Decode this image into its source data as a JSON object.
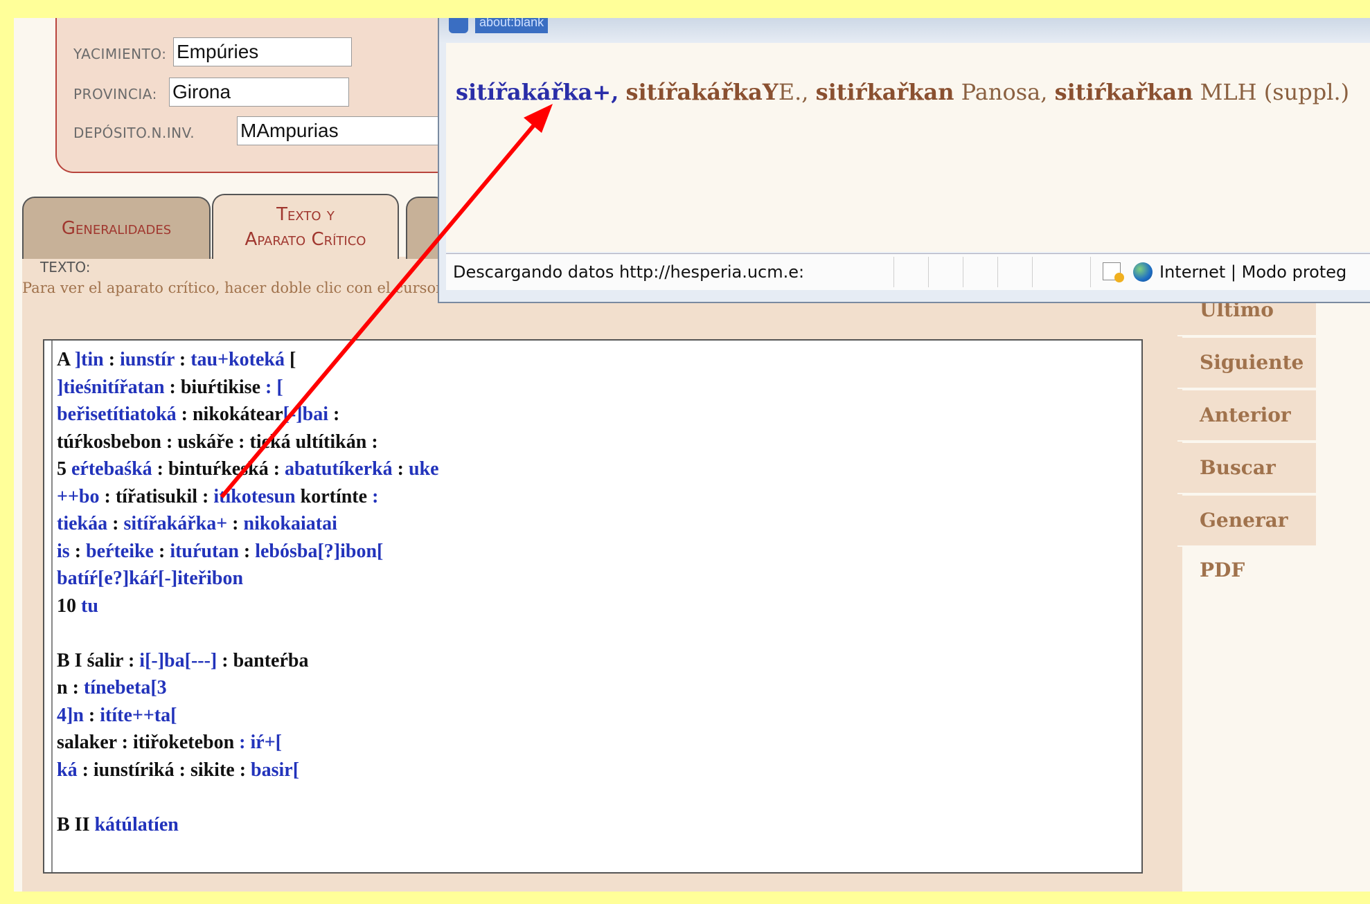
{
  "info": {
    "yacimiento_label": "YACIMIENTO:",
    "yacimiento_value": "Empúries",
    "provincia_label": "PROVINCIA:",
    "provincia_value": "Girona",
    "deposito_label": "DEPÓSITO.N.INV.",
    "deposito_value": "MAmpurias"
  },
  "tabs": {
    "generalidades": "Generalidades",
    "texto_line1": "Texto y",
    "texto_line2": "Aparato Crítico"
  },
  "texto_label": "TEXTO:",
  "hint": "Para ver el aparato crítico, hacer doble clic con el cursor sobre cada sección azul, y un clic para cerrar la ventana emergente",
  "text_lines": [
    [
      [
        "A ",
        "k"
      ],
      [
        "]tin",
        "b"
      ],
      [
        " : ",
        "k"
      ],
      [
        "iunstír",
        "b"
      ],
      [
        " : ",
        "k"
      ],
      [
        "tau+koteká",
        "b"
      ],
      [
        " [",
        "k"
      ]
    ],
    [
      [
        "]tieśnitířatan",
        "b"
      ],
      [
        " : ",
        "k"
      ],
      [
        "biuŕtikise",
        "k"
      ],
      [
        " : [",
        "b"
      ]
    ],
    [
      [
        "beřisetítiatoká",
        "b"
      ],
      [
        " : ",
        "k"
      ],
      [
        "nikokátear",
        "k"
      ],
      [
        "[-]bai",
        "b"
      ],
      [
        " :",
        "k"
      ]
    ],
    [
      [
        "túŕkosbebon",
        "k"
      ],
      [
        " : ",
        "k"
      ],
      [
        "uskáře",
        "k"
      ],
      [
        " : ",
        "k"
      ],
      [
        "tieká ultítikán",
        "k"
      ],
      [
        " :",
        "k"
      ]
    ],
    [
      [
        "5 ",
        "k"
      ],
      [
        "eŕtebaśká",
        "b"
      ],
      [
        " : ",
        "k"
      ],
      [
        "bintuŕkeská",
        "k"
      ],
      [
        " : ",
        "k"
      ],
      [
        "abatutíkerká",
        "b"
      ],
      [
        " : ",
        "k"
      ],
      [
        "uke",
        "b"
      ]
    ],
    [
      [
        "++bo",
        "b"
      ],
      [
        " : ",
        "k"
      ],
      [
        "tířatisukil",
        "k"
      ],
      [
        " : ",
        "k"
      ],
      [
        "itíkotesun",
        "b"
      ],
      [
        " ",
        "k"
      ],
      [
        "kortínte",
        "k"
      ],
      [
        " :",
        "b"
      ]
    ],
    [
      [
        "tiekáa",
        "b"
      ],
      [
        " : ",
        "k"
      ],
      [
        "sitířakářka+",
        "b"
      ],
      [
        " : ",
        "k"
      ],
      [
        "nikokaiatai",
        "b"
      ]
    ],
    [
      [
        "is",
        "b"
      ],
      [
        " : ",
        "k"
      ],
      [
        "beŕteike",
        "b"
      ],
      [
        " : ",
        "k"
      ],
      [
        "ituŕutan",
        "b"
      ],
      [
        " : ",
        "k"
      ],
      [
        "lebósba[?]ibon[",
        "b"
      ]
    ],
    [
      [
        "batíŕ[e?]káŕ[-]iteřibon",
        "b"
      ]
    ],
    [
      [
        "10 ",
        "k"
      ],
      [
        "tu",
        "b"
      ]
    ],
    [],
    [
      [
        "B I ",
        "k"
      ],
      [
        "śalir",
        "k"
      ],
      [
        " : ",
        "k"
      ],
      [
        "i[-]ba[---]",
        "b"
      ],
      [
        " : ",
        "k"
      ],
      [
        "banteŕba",
        "k"
      ]
    ],
    [
      [
        "n",
        "k"
      ],
      [
        " : ",
        "k"
      ],
      [
        "tínebeta[3",
        "b"
      ]
    ],
    [
      [
        "4]n",
        "b"
      ],
      [
        " : ",
        "k"
      ],
      [
        "itíte++ta[",
        "b"
      ]
    ],
    [
      [
        "salaker",
        "k"
      ],
      [
        " : ",
        "k"
      ],
      [
        "itiřoketebon",
        "k"
      ],
      [
        " : ",
        "b"
      ],
      [
        "iŕ+[",
        "b"
      ]
    ],
    [
      [
        "ká",
        "b"
      ],
      [
        " : ",
        "k"
      ],
      [
        "iunstíriká",
        "k"
      ],
      [
        " : ",
        "k"
      ],
      [
        "sikite",
        "k"
      ],
      [
        " : ",
        "k"
      ],
      [
        "basir[",
        "b"
      ]
    ],
    [],
    [
      [
        "B II ",
        "k"
      ],
      [
        "kátúlatíen",
        "b"
      ]
    ]
  ],
  "nav": [
    "Último",
    "Siguiente",
    "Anterior",
    "Buscar",
    "Generar PDF"
  ],
  "popup": {
    "url": "about:blank",
    "reading1": "sitířakářka+,",
    "reading2": "sitířakářkaY",
    "src2": "E.,",
    "reading3": "sitiŕkařkan",
    "src3": "Panosa,",
    "reading4": "sitiŕkařkan",
    "src4": "MLH (suppl.)",
    "status_text": "Descargando datos http://hesperia.ucm.e:",
    "zone_text": "Internet | Modo proteg"
  },
  "colors": {
    "background": "#ffff99",
    "accent_red": "#a0372f",
    "blue_section": "#2233bb",
    "arrow": "#ff0000"
  }
}
